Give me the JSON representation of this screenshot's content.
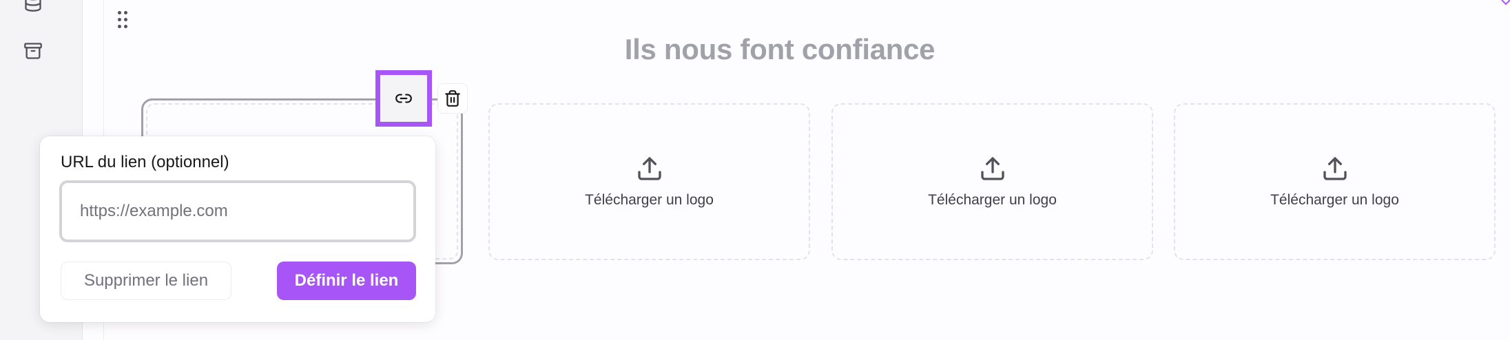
{
  "sidebar": {
    "icons": [
      {
        "name": "database-icon"
      },
      {
        "name": "archive-icon"
      }
    ]
  },
  "section": {
    "title": "Ils nous font confiance"
  },
  "logo_slots": [
    {
      "label": ""
    },
    {
      "label": "Télécharger un logo"
    },
    {
      "label": "Télécharger un logo"
    },
    {
      "label": "Télécharger un logo"
    }
  ],
  "toolbar": {
    "link_icon": "link-icon",
    "delete_icon": "trash-icon"
  },
  "link_popover": {
    "label": "URL du lien (optionnel)",
    "input_placeholder": "https://example.com",
    "input_value": "",
    "remove_label": "Supprimer le lien",
    "define_label": "Définir le lien"
  },
  "colors": {
    "accent": "#a855f7",
    "title": "#a1a1aa"
  }
}
